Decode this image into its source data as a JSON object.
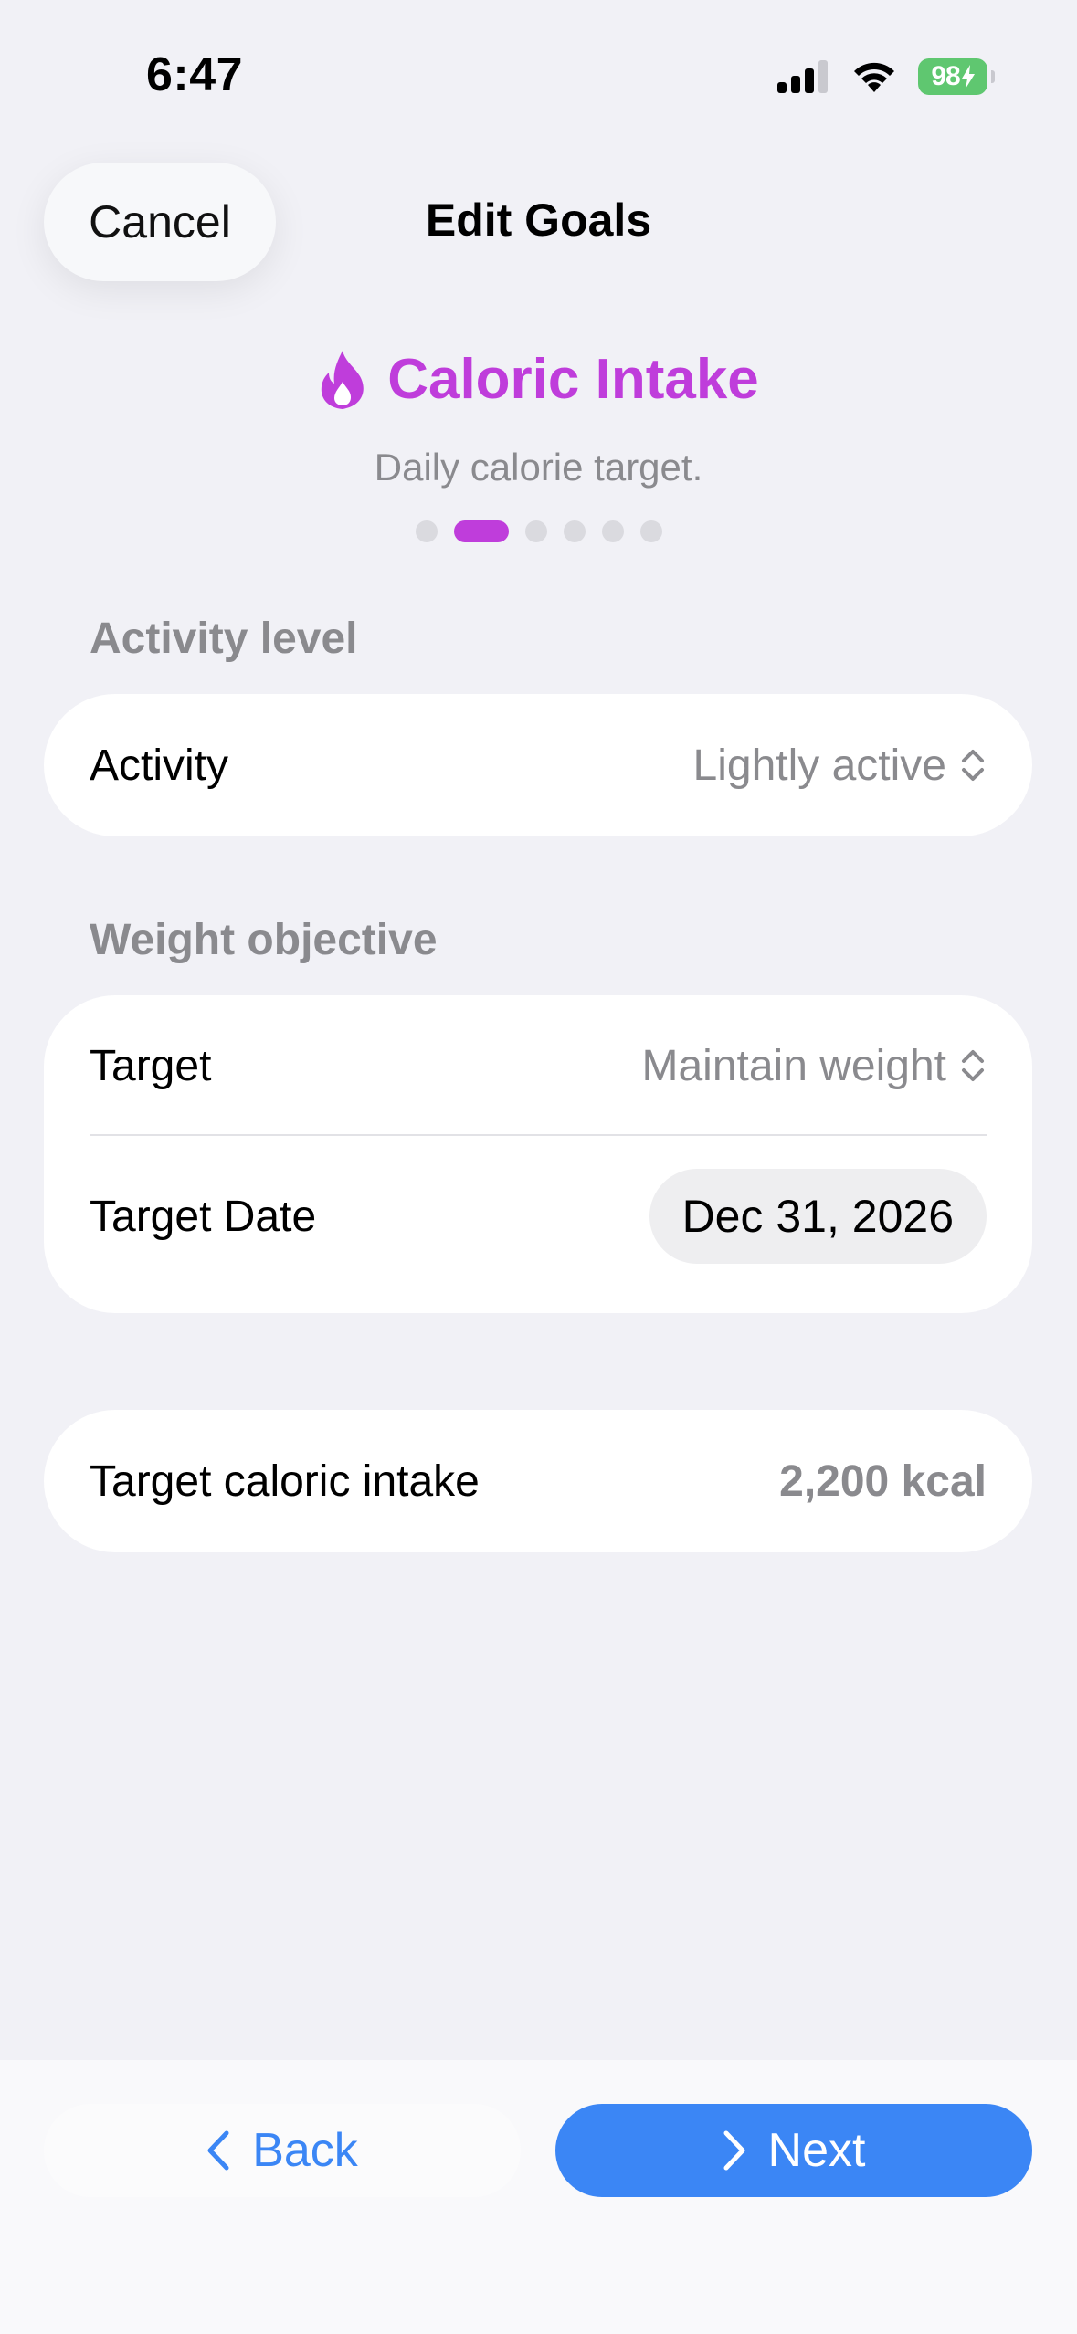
{
  "status_bar": {
    "time": "6:47",
    "battery": "98",
    "battery_color": "#5FC770"
  },
  "header": {
    "cancel_label": "Cancel",
    "title": "Edit Goals"
  },
  "goal": {
    "icon": "flame-icon",
    "title": "Caloric Intake",
    "subtitle": "Daily calorie target.",
    "accent": "#BF3DDB",
    "page_count": 6,
    "current_page": 2
  },
  "activity_section": {
    "label": "Activity level",
    "row_label": "Activity",
    "row_value": "Lightly active"
  },
  "weight_section": {
    "label": "Weight objective",
    "target_label": "Target",
    "target_value": "Maintain weight",
    "date_label": "Target Date",
    "date_value": "Dec 31, 2026"
  },
  "summary": {
    "label": "Target caloric intake",
    "value": "2,200 kcal"
  },
  "footer": {
    "back_label": "Back",
    "next_label": "Next",
    "primary_color": "#3B86F5"
  }
}
